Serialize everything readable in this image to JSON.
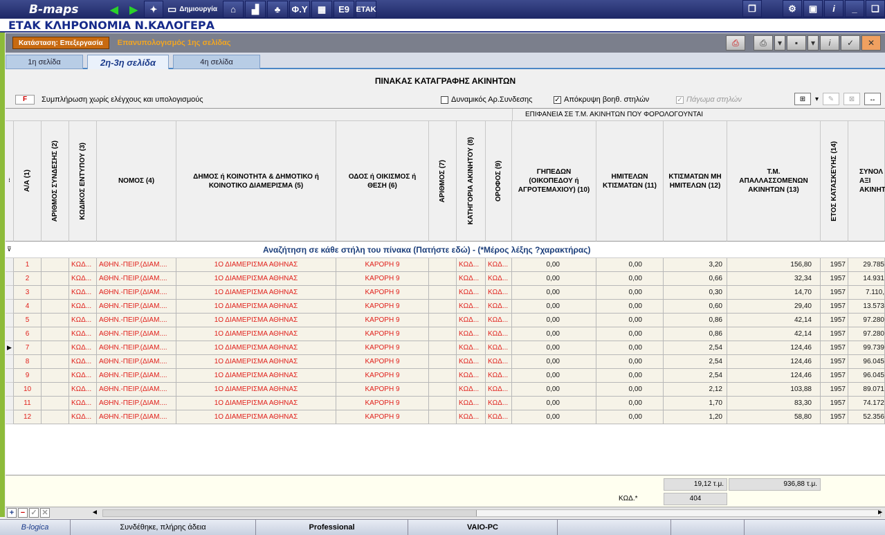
{
  "topbar": {
    "logo": "B-maps",
    "create_label": "Δημιουργία",
    "fy_label": "Φ.Υ",
    "e9_label": "Ε9",
    "etak_label": "ΕΤΑΚ",
    "info_label": "i"
  },
  "window_title": "ΕΤΑΚ ΚΛΗΡΟΝΟΜΙΑ Ν.ΚΑΛΟΓΕΡΑ",
  "status": {
    "state_label": "Κατάσταση: Επεξεργασία",
    "recalc_label": "Επανυπολογισμός 1ης σελίδας"
  },
  "tabs": [
    "1η σελίδα",
    "2η-3η σελίδα",
    "4η σελίδα"
  ],
  "sheet_title": "ΠΙΝΑΚΑΣ ΚΑΤΑΓΡΑΦΗΣ ΑΚΙΝΗΤΩΝ",
  "fill_button": "F",
  "fill_label": "Συμπλήρωση χωρίς ελέγχους και υπολογισμούς",
  "options": {
    "dynamic_label": "Δυναμικός Αρ.Συνδεσης",
    "hide_label": "Απόκρυψη βοηθ. στηλών",
    "freeze_label": "Πάγωμα στηλών"
  },
  "band_label": "ΕΠΙΦΑΝΕΙΑ ΣΕ Τ.Μ. ΑΚΙΝΗΤΩΝ ΠΟΥ ΦΟΡΟΛΟΓΟΥΝΤΑΙ",
  "columns": [
    "Α/Α (1)",
    "ΑΡΙΘΜΟΣ ΣΥΝΔΕΣΗΣ (2)",
    "ΚΩΔΙΚΟΣ ΕΝΤΥΠΟΥ (3)",
    "ΝΟΜΟΣ (4)",
    "ΔΗΜΟΣ ή ΚΟΙΝΟΤΗΤΑ & ΔΗΜΟΤΙΚΟ ή ΚΟΙΝΟΤΙΚΟ ΔΙΑΜΕΡΙΣΜΑ (5)",
    "ΟΔΟΣ ή ΟΙΚΙΣΜΟΣ ή ΘΕΣΗ (6)",
    "ΑΡΙΘΜΟΣ (7)",
    "ΚΑΤΗΓΟΡΙΑ ΑΚΙΝΗΤΟΥ (8)",
    "ΟΡΟΦΟΣ (9)",
    "ΓΗΠΕΔΩΝ (ΟΙΚΟΠΕΔΟΥ ή ΑΓΡΟΤΕΜΑΧΙΟΥ) (10)",
    "ΗΜΙΤΕΛΩΝ ΚΤΙΣΜΑΤΩΝ (11)",
    "ΚΤΙΣΜΑΤΩΝ ΜΗ ΗΜΙΤΕΛΩΝ (12)",
    "Τ.Μ. ΑΠΑΛΛΑΣΣΟΜΕΝΩΝ ΑΚΙΝΗΤΩΝ (13)",
    "ΕΤΟΣ ΚΑΤΑΣΚΕΥΗΣ (14)",
    "ΣΥΝΟΛ ΑΞΙ ΑΚΙΝΗΤΟ"
  ],
  "search_hint": "Αναζήτηση σε κάθε στήλη του πίνακα (Πατήστε εδώ) - (*Μέρος λέξης ?χαρακτήρας)",
  "rows": [
    {
      "aa": "1",
      "code": "ΚΩΔ...",
      "nomos": "ΑΘΗΝ.-ΠΕΙΡ.(ΔΙΑΜ....",
      "dimos": "1Ο ΔΙΑΜΕΡΙΣΜΑ ΑΘΗΝΑΣ",
      "odos": "ΚΑΡΟΡΗ 9",
      "kat": "ΚΩΔ...",
      "orofos": "ΚΩΔ...",
      "gip": "0,00",
      "imit": "0,00",
      "ktism": "3,20",
      "apal": "156,80",
      "etos": "1957",
      "synol": "29.785"
    },
    {
      "aa": "2",
      "code": "ΚΩΔ...",
      "nomos": "ΑΘΗΝ.-ΠΕΙΡ.(ΔΙΑΜ....",
      "dimos": "1Ο ΔΙΑΜΕΡΙΣΜΑ ΑΘΗΝΑΣ",
      "odos": "ΚΑΡΟΡΗ 9",
      "kat": "ΚΩΔ...",
      "orofos": "ΚΩΔ...",
      "gip": "0,00",
      "imit": "0,00",
      "ktism": "0,66",
      "apal": "32,34",
      "etos": "1957",
      "synol": "14.931"
    },
    {
      "aa": "3",
      "code": "ΚΩΔ...",
      "nomos": "ΑΘΗΝ.-ΠΕΙΡ.(ΔΙΑΜ....",
      "dimos": "1Ο ΔΙΑΜΕΡΙΣΜΑ ΑΘΗΝΑΣ",
      "odos": "ΚΑΡΟΡΗ 9",
      "kat": "ΚΩΔ...",
      "orofos": "ΚΩΔ...",
      "gip": "0,00",
      "imit": "0,00",
      "ktism": "0,30",
      "apal": "14,70",
      "etos": "1957",
      "synol": "7.110,"
    },
    {
      "aa": "4",
      "code": "ΚΩΔ...",
      "nomos": "ΑΘΗΝ.-ΠΕΙΡ.(ΔΙΑΜ....",
      "dimos": "1Ο ΔΙΑΜΕΡΙΣΜΑ ΑΘΗΝΑΣ",
      "odos": "ΚΑΡΟΡΗ 9",
      "kat": "ΚΩΔ...",
      "orofos": "ΚΩΔ...",
      "gip": "0,00",
      "imit": "0,00",
      "ktism": "0,60",
      "apal": "29,40",
      "etos": "1957",
      "synol": "13.573"
    },
    {
      "aa": "5",
      "code": "ΚΩΔ...",
      "nomos": "ΑΘΗΝ.-ΠΕΙΡ.(ΔΙΑΜ....",
      "dimos": "1Ο ΔΙΑΜΕΡΙΣΜΑ ΑΘΗΝΑΣ",
      "odos": "ΚΑΡΟΡΗ 9",
      "kat": "ΚΩΔ...",
      "orofos": "ΚΩΔ...",
      "gip": "0,00",
      "imit": "0,00",
      "ktism": "0,86",
      "apal": "42,14",
      "etos": "1957",
      "synol": "97.280"
    },
    {
      "aa": "6",
      "code": "ΚΩΔ...",
      "nomos": "ΑΘΗΝ.-ΠΕΙΡ.(ΔΙΑΜ....",
      "dimos": "1Ο ΔΙΑΜΕΡΙΣΜΑ ΑΘΗΝΑΣ",
      "odos": "ΚΑΡΟΡΗ 9",
      "kat": "ΚΩΔ...",
      "orofos": "ΚΩΔ...",
      "gip": "0,00",
      "imit": "0,00",
      "ktism": "0,86",
      "apal": "42,14",
      "etos": "1957",
      "synol": "97.280"
    },
    {
      "aa": "7",
      "code": "ΚΩΔ...",
      "nomos": "ΑΘΗΝ.-ΠΕΙΡ.(ΔΙΑΜ....",
      "dimos": "1Ο ΔΙΑΜΕΡΙΣΜΑ ΑΘΗΝΑΣ",
      "odos": "ΚΑΡΟΡΗ 9",
      "kat": "ΚΩΔ...",
      "orofos": "ΚΩΔ...",
      "gip": "0,00",
      "imit": "0,00",
      "ktism": "2,54",
      "apal": "124,46",
      "etos": "1957",
      "synol": "99.739"
    },
    {
      "aa": "8",
      "code": "ΚΩΔ...",
      "nomos": "ΑΘΗΝ.-ΠΕΙΡ.(ΔΙΑΜ....",
      "dimos": "1Ο ΔΙΑΜΕΡΙΣΜΑ ΑΘΗΝΑΣ",
      "odos": "ΚΑΡΟΡΗ 9",
      "kat": "ΚΩΔ...",
      "orofos": "ΚΩΔ...",
      "gip": "0,00",
      "imit": "0,00",
      "ktism": "2,54",
      "apal": "124,46",
      "etos": "1957",
      "synol": "96.045"
    },
    {
      "aa": "9",
      "code": "ΚΩΔ...",
      "nomos": "ΑΘΗΝ.-ΠΕΙΡ.(ΔΙΑΜ....",
      "dimos": "1Ο ΔΙΑΜΕΡΙΣΜΑ ΑΘΗΝΑΣ",
      "odos": "ΚΑΡΟΡΗ 9",
      "kat": "ΚΩΔ...",
      "orofos": "ΚΩΔ...",
      "gip": "0,00",
      "imit": "0,00",
      "ktism": "2,54",
      "apal": "124,46",
      "etos": "1957",
      "synol": "96.045"
    },
    {
      "aa": "10",
      "code": "ΚΩΔ...",
      "nomos": "ΑΘΗΝ.-ΠΕΙΡ.(ΔΙΑΜ....",
      "dimos": "1Ο ΔΙΑΜΕΡΙΣΜΑ ΑΘΗΝΑΣ",
      "odos": "ΚΑΡΟΡΗ 9",
      "kat": "ΚΩΔ...",
      "orofos": "ΚΩΔ...",
      "gip": "0,00",
      "imit": "0,00",
      "ktism": "2,12",
      "apal": "103,88",
      "etos": "1957",
      "synol": "89.071"
    },
    {
      "aa": "11",
      "code": "ΚΩΔ...",
      "nomos": "ΑΘΗΝ.-ΠΕΙΡ.(ΔΙΑΜ....",
      "dimos": "1Ο ΔΙΑΜΕΡΙΣΜΑ ΑΘΗΝΑΣ",
      "odos": "ΚΑΡΟΡΗ 9",
      "kat": "ΚΩΔ...",
      "orofos": "ΚΩΔ...",
      "gip": "0,00",
      "imit": "0,00",
      "ktism": "1,70",
      "apal": "83,30",
      "etos": "1957",
      "synol": "74.172"
    },
    {
      "aa": "12",
      "code": "ΚΩΔ...",
      "nomos": "ΑΘΗΝ.-ΠΕΙΡ.(ΔΙΑΜ....",
      "dimos": "1Ο ΔΙΑΜΕΡΙΣΜΑ ΑΘΗΝΑΣ",
      "odos": "ΚΑΡΟΡΗ 9",
      "kat": "ΚΩΔ...",
      "orofos": "ΚΩΔ...",
      "gip": "0,00",
      "imit": "0,00",
      "ktism": "1,20",
      "apal": "58,80",
      "etos": "1957",
      "synol": "52.356"
    }
  ],
  "current_row_marker": "▶",
  "totals": {
    "ktism_total": "19,12 τ.μ.",
    "apal_total": "936,88 τ.μ.",
    "kod_label": "ΚΩΔ.*",
    "kod_value": "404"
  },
  "statusbar": {
    "brand": "B-logica",
    "connection": "Συνδέθηκε, πλήρης άδεια",
    "edition": "Professional",
    "machine": "VAIO-PC"
  },
  "colors": {
    "toolbar_bg": "#27306f",
    "title_text": "#162a8a",
    "state_button": "#c86a10",
    "recalc_text": "#f2a622",
    "cell_text": "#e0201b",
    "search_text": "#1b3e7a"
  }
}
